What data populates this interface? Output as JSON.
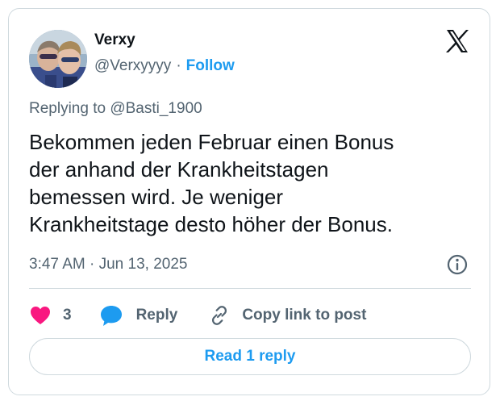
{
  "author": {
    "name": "Verxy",
    "handle": "@Verxyyyy",
    "separator": "·",
    "follow_label": "Follow"
  },
  "reply_context": "Replying to @Basti_1900",
  "tweet": {
    "lines": [
      "Bekommen jeden Februar einen Bonus",
      "der anhand der Krankheitstagen",
      "bemessen wird. Je weniger",
      "Krankheitstage desto höher der Bonus."
    ]
  },
  "timestamp": "3:47 AM · Jun 13, 2025",
  "actions": {
    "like_count": "3",
    "reply_label": "Reply",
    "copy_link_label": "Copy link to post"
  },
  "read_replies_label": "Read 1 reply",
  "icons": {
    "logo": "x-logo-icon",
    "info": "info-icon",
    "like": "heart-icon",
    "reply": "speech-bubble-icon",
    "copy": "link-icon"
  },
  "colors": {
    "accent": "#1d9bf0",
    "like": "#f91880",
    "muted": "#536471",
    "text": "#0f1419",
    "border": "#cfd9de"
  }
}
